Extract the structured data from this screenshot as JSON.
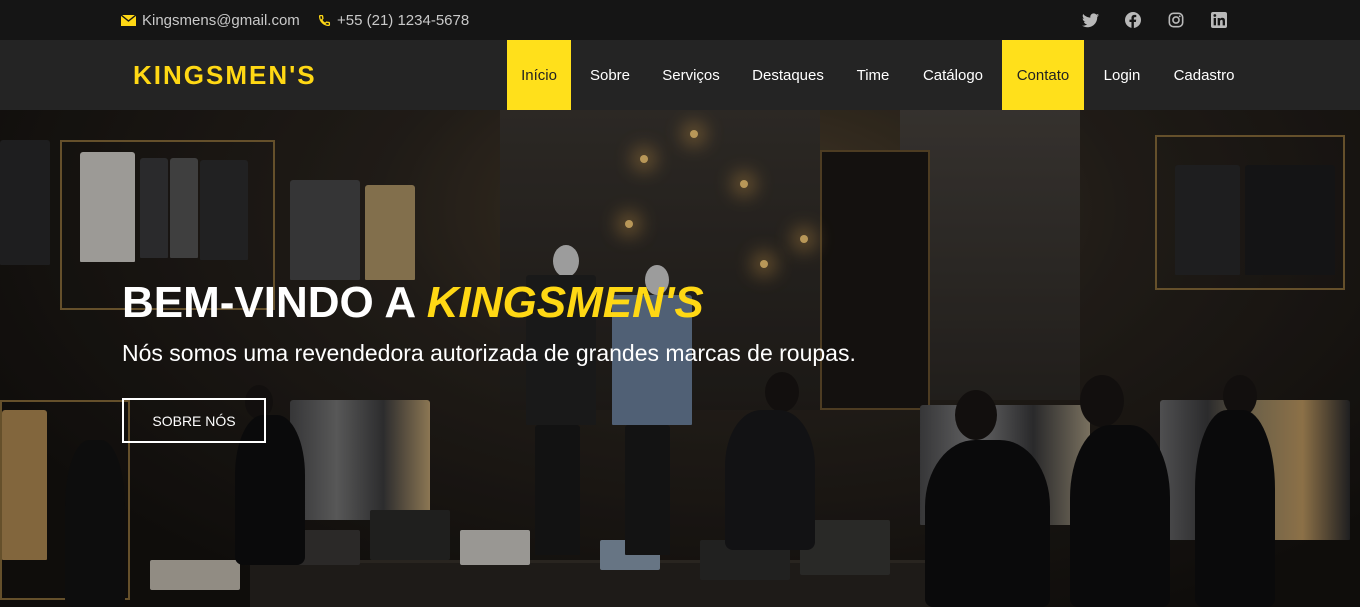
{
  "topbar": {
    "email": "Kingsmens@gmail.com",
    "phone": "+55 (21) 1234-5678",
    "socials": [
      "twitter-icon",
      "facebook-icon",
      "instagram-icon",
      "linkedin-icon"
    ]
  },
  "brand": {
    "logo": "KINGSMEN'S",
    "accent_color": "#ffe01b"
  },
  "nav": {
    "items": [
      "Início",
      "Sobre",
      "Serviços",
      "Destaques",
      "Time",
      "Catálogo",
      "Contato",
      "Login",
      "Cadastro"
    ],
    "highlighted": [
      "Início",
      "Contato"
    ]
  },
  "hero": {
    "title_prefix": "BEM-VINDO A ",
    "title_accent": "KINGSMEN'S",
    "subtitle": "Nós somos uma revendedora autorizada de grandes marcas de roupas.",
    "button": "SOBRE NÓS"
  }
}
